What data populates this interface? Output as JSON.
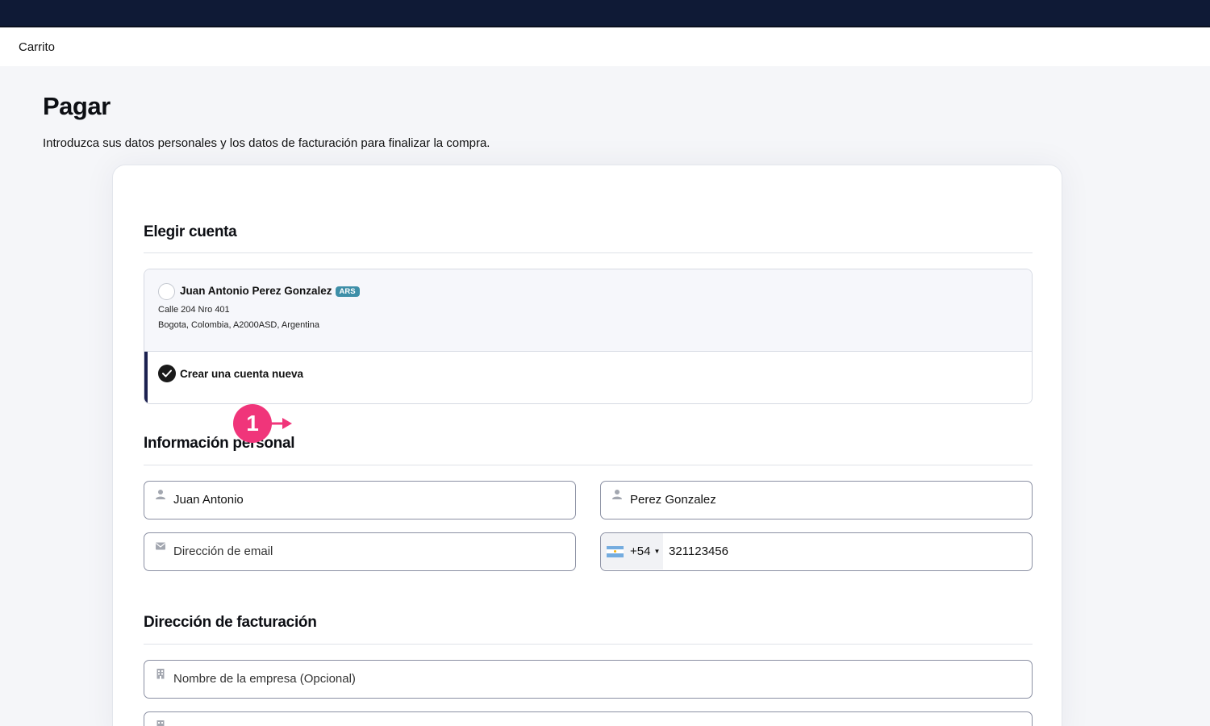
{
  "navbar": {
    "cart_label": "Carrito"
  },
  "page": {
    "title": "Pagar",
    "subtitle": "Introduzca sus datos personales y los datos de facturación para finalizar la compra."
  },
  "choose_account": {
    "title": "Elegir cuenta",
    "existing": {
      "name": "Juan Antonio Perez Gonzalez",
      "currency_badge": "ARS",
      "address_line1": "Calle 204 Nro 401",
      "address_line2": "Bogota, Colombia, A2000ASD, Argentina",
      "selected": false
    },
    "new_account": {
      "label": "Crear una cuenta nueva",
      "selected": true
    }
  },
  "personal_info": {
    "title": "Información personal",
    "first_name": {
      "value": "Juan Antonio",
      "placeholder": ""
    },
    "last_name": {
      "value": "Perez Gonzalez",
      "placeholder": ""
    },
    "email": {
      "value": "",
      "placeholder": "Dirección de email"
    },
    "phone": {
      "dial_code": "+54",
      "value": "321123456",
      "country_icon": "argentina-flag-icon"
    }
  },
  "billing": {
    "title": "Dirección de facturación",
    "company": {
      "value": "",
      "placeholder": "Nombre de la empresa (Opcional)"
    }
  },
  "annotation": {
    "step": "1",
    "color": "#f0357a"
  },
  "colors": {
    "topbar": "#0f1a36",
    "badge": "#3e8fa8",
    "selected_accent": "#1c2150"
  }
}
